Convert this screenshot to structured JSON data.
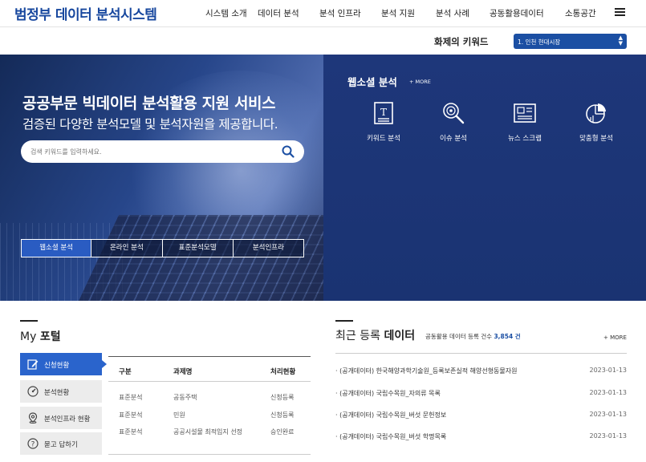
{
  "header": {
    "logo": "범정부 데이터 분석시스템",
    "nav": [
      "시스템 소개",
      "데이터 분석",
      "분석 인프라",
      "분석 지원",
      "분석 사례",
      "공동활용데이터",
      "소통공간"
    ]
  },
  "keyword_bar": {
    "label": "화제의 키워드",
    "selected": "1. 인천 현대시장"
  },
  "hero": {
    "title": "공공부문 빅데이터 분석활용 지원 서비스",
    "subtitle": "검증된 다양한 분석모델 및 분석자원을 제공합니다.",
    "search_placeholder": "검색 키워드를 입력하세요.",
    "tabs": [
      "웹소셜 분석",
      "온라인 분석",
      "표준분석모델",
      "분석인프라"
    ]
  },
  "social": {
    "title": "웹소셜 분석",
    "more": "+ MORE",
    "items": [
      {
        "label": "키워드 분석",
        "icon": "keyword-document-icon"
      },
      {
        "label": "이슈 분석",
        "icon": "issue-magnifier-icon"
      },
      {
        "label": "뉴스 스크랩",
        "icon": "news-icon"
      },
      {
        "label": "맞춤형 분석",
        "icon": "pie-chart-icon"
      }
    ]
  },
  "my_portal": {
    "title_prefix": "My",
    "title_bold": "포털",
    "menu": [
      {
        "label": "신청현황",
        "icon": "edit-icon"
      },
      {
        "label": "분석현황",
        "icon": "gauge-icon"
      },
      {
        "label": "분석인프라 현황",
        "icon": "location-pin-icon"
      },
      {
        "label": "묻고 답하기",
        "icon": "question-icon"
      }
    ],
    "table": {
      "headers": [
        "구분",
        "과제명",
        "처리현황"
      ],
      "rows": [
        [
          "표준분석",
          "공동주택",
          "신청등록"
        ],
        [
          "표준분석",
          "민원",
          "신청등록"
        ],
        [
          "표준분석",
          "공공시설물 최적입지 선정",
          "승인완료"
        ]
      ]
    }
  },
  "recent": {
    "title_prefix": "최근 등록",
    "title_bold": "데이터",
    "count_label": "공동활용 데이터 등록 건수",
    "count_value": "3,854 건",
    "more": "+ MORE",
    "items": [
      {
        "title": "· (공개데이터) 한국해양과학기술원_등록보존실적 해양선형동물자원",
        "date": "2023-01-13"
      },
      {
        "title": "· (공개데이터) 국립수목원_자의류 목록",
        "date": "2023-01-13"
      },
      {
        "title": "· (공개데이터) 국립수목원_버섯 문헌정보",
        "date": "2023-01-13"
      },
      {
        "title": "· (공개데이터) 국립수목원_버섯 학명목록",
        "date": "2023-01-13"
      }
    ]
  },
  "colors": {
    "brand": "#17479e",
    "accent": "#2a64cc",
    "panel": "#1e377a"
  }
}
